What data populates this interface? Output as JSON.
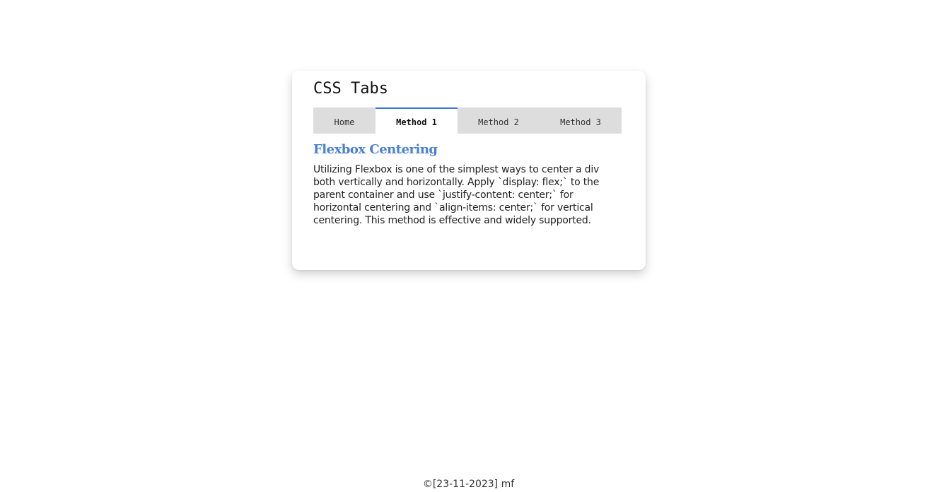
{
  "card": {
    "title": "CSS Tabs",
    "tabs": [
      {
        "label": "Home",
        "active": false
      },
      {
        "label": "Method 1",
        "active": true
      },
      {
        "label": "Method 2",
        "active": false
      },
      {
        "label": "Method 3",
        "active": false
      }
    ],
    "content": {
      "heading": "Flexbox Centering",
      "text": "Utilizing Flexbox is one of the simplest ways to center a div both vertically and horizontally. Apply `display: flex;` to the parent container and use `justify-content: center;` for horizontal centering and `align-items: center;` for vertical centering. This method is effective and widely supported."
    }
  },
  "footer": {
    "text": "©[23-11-2023] mf"
  },
  "colors": {
    "accent": "#3a7bd5",
    "heading": "#4a7fd4",
    "tab_bar": "#dddddd"
  }
}
